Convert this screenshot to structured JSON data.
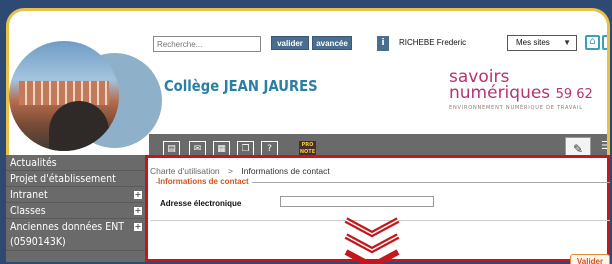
{
  "search": {
    "placeholder": "Recherche...",
    "valider_label": "valider",
    "avancee_label": "avancée"
  },
  "user": {
    "name": "RICHEBE Frederic",
    "icon": "user-icon"
  },
  "sites_select": {
    "selected": "Mes sites"
  },
  "header": {
    "school_title": "Collège JEAN JAURES",
    "logo_line1": "savoirs",
    "logo_line2_word": "numériques",
    "logo_line2_num": "59 62",
    "logo_subtitle": "ENVIRONNEMENT NUMÉRIQUE DE TRAVAIL"
  },
  "toolbar": {
    "icons": [
      "document-icon",
      "mail-icon",
      "calendar-icon",
      "copy-icon",
      "help-icon",
      "pronote-icon",
      "edit-icon",
      "menu-icon"
    ],
    "help_label": "?",
    "pronote_label": "PRO NOTE"
  },
  "nav": {
    "items": [
      {
        "label": "Actualités",
        "expandable": false
      },
      {
        "label": "Projet d'établissement",
        "expandable": false
      },
      {
        "label": "Intranet",
        "expandable": true
      },
      {
        "label": "Classes",
        "expandable": true
      },
      {
        "label": "Anciennes données ENT (0590143K)",
        "expandable": true
      }
    ],
    "plus_label": "+"
  },
  "content": {
    "breadcrumb_root": "Charte d'utilisation",
    "breadcrumb_sep": ">",
    "breadcrumb_current": "Informations de contact",
    "legend": "Informations de contact",
    "email_label": "Adresse électronique",
    "email_value": "",
    "submit_label": "Valider"
  },
  "colors": {
    "accent_blue": "#2a7fa4",
    "brand_magenta": "#b5336f",
    "frame_gold": "#e7c14a",
    "highlight_red": "#c4161c",
    "legend_orange": "#d4531e"
  }
}
